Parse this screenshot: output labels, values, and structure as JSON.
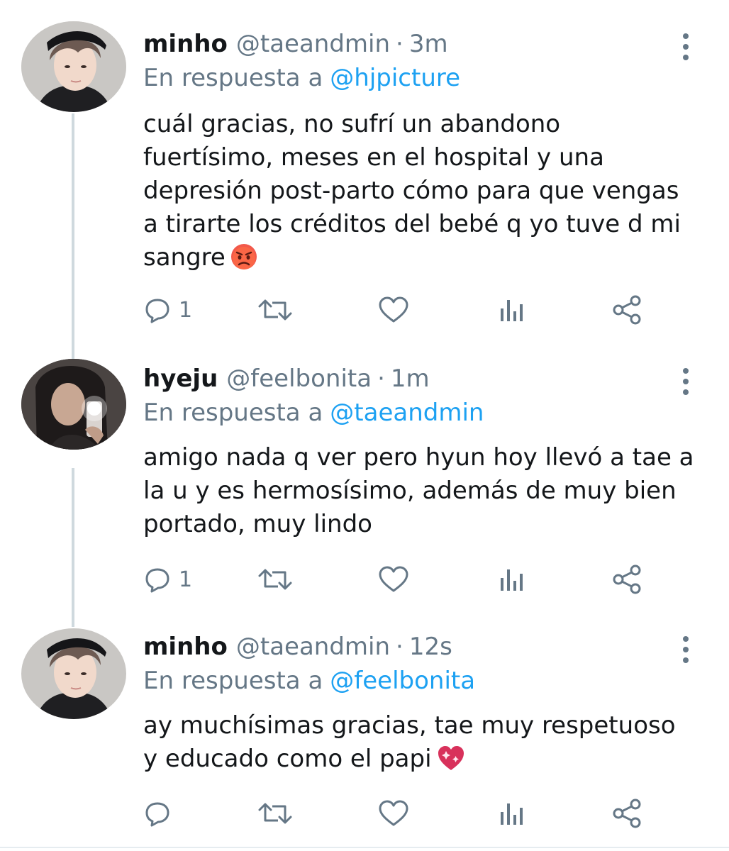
{
  "tweets": [
    {
      "name": "minho",
      "handle": "@taeandmin",
      "time": "3m",
      "reply_prefix": "En respuesta a",
      "reply_mention": "@hjpicture",
      "text": "cuál gracias, no sufrí un abandono\nfuertísimo, meses en el hospital y una\ndepresión post-parto cómo para que vengas\na tirarte los créditos del bebé q yo tuve d mi\nsangre",
      "emoji": "angry-face-emoji",
      "reply_count": "1",
      "icons": [
        "reply-icon",
        "retweet-icon",
        "like-icon",
        "analytics-icon",
        "share-icon",
        "more-icon"
      ]
    },
    {
      "name": "hyeju",
      "handle": "@feelbonita",
      "time": "1m",
      "reply_prefix": "En respuesta a",
      "reply_mention": "@taeandmin",
      "text": "amigo nada q ver pero hyun hoy llevó a tae a\nla u y es hermosísimo, además de muy bien\nportado, muy lindo",
      "emoji": "",
      "reply_count": "1",
      "icons": [
        "reply-icon",
        "retweet-icon",
        "like-icon",
        "analytics-icon",
        "share-icon",
        "more-icon"
      ]
    },
    {
      "name": "minho",
      "handle": "@taeandmin",
      "time": "12s",
      "reply_prefix": "En respuesta a",
      "reply_mention": "@feelbonita",
      "text": "ay muchísimas gracias, tae muy respetuoso\ny educado como el papi",
      "emoji": "sparkling-heart-emoji",
      "reply_count": "",
      "icons": [
        "reply-icon",
        "retweet-icon",
        "like-icon",
        "analytics-icon",
        "share-icon",
        "more-icon"
      ]
    }
  ],
  "colors": {
    "text": "#14171a",
    "secondary": "#657786",
    "link": "#1da1f2",
    "thread_line": "#cfd9de"
  },
  "separator": "·"
}
